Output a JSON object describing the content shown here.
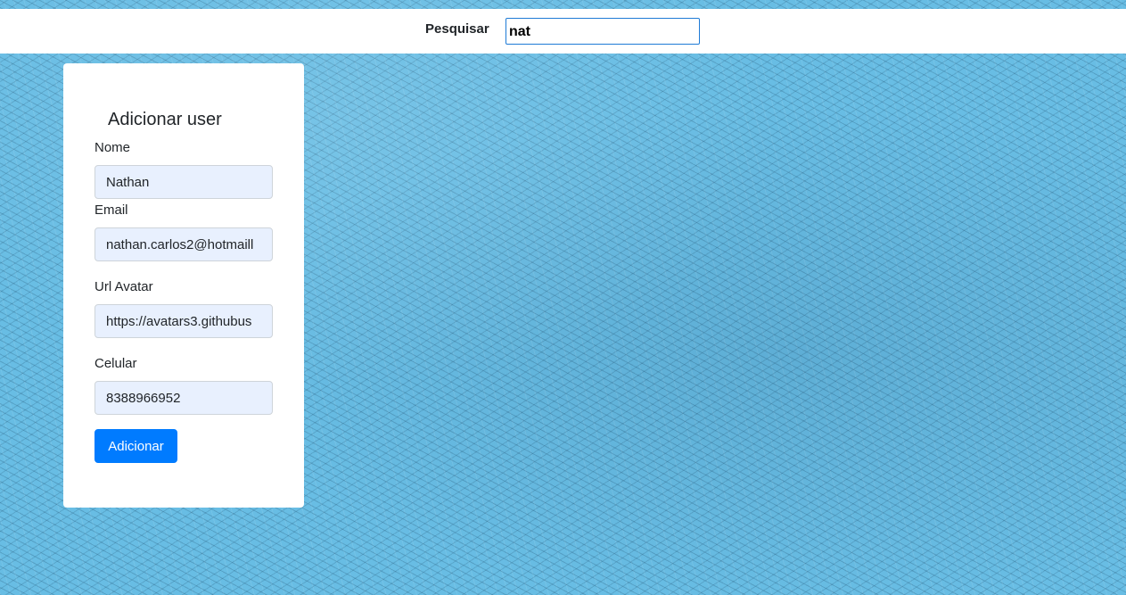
{
  "header": {
    "search_label": "Pesquisar",
    "search_value": "nat"
  },
  "form": {
    "title": "Adicionar user",
    "fields": [
      {
        "label": "Nome",
        "value": "Nathan"
      },
      {
        "label": "Email",
        "value": "nathan.carlos2@hotmaill"
      },
      {
        "label": "Url Avatar",
        "value": "https://avatars3.githubus"
      },
      {
        "label": "Celular",
        "value": "8388966952"
      }
    ],
    "submit_label": "Adicionar"
  },
  "colors": {
    "background": "#68bde4",
    "primary": "#007bff",
    "autofill": "#e8f0fe"
  }
}
